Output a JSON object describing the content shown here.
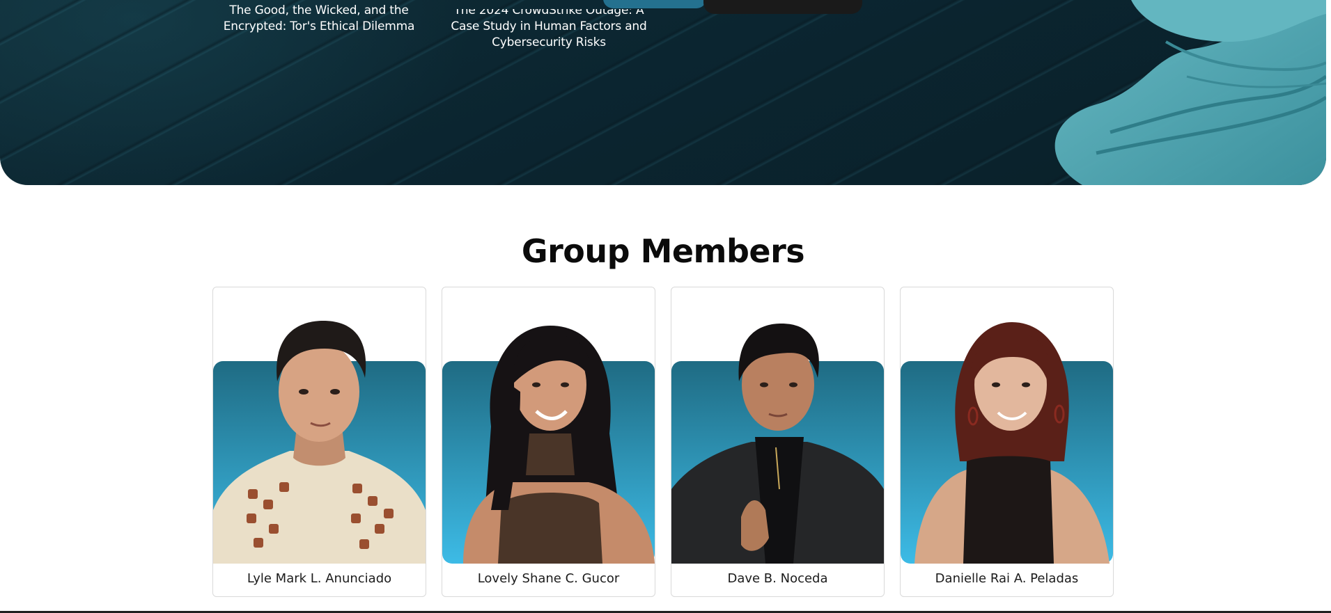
{
  "hero": {
    "cards": [
      {
        "title_line1": "The Good, the Wicked, and the",
        "title_line2": "Encrypted: Tor's Ethical Dilemma"
      },
      {
        "title_line1": "The 2024 CrowdStrike Outage: A",
        "title_line2": "Case Study in Human Factors and",
        "title_line3": "Cybersecurity Risks"
      }
    ]
  },
  "members_section": {
    "title": "Group Members",
    "members": [
      {
        "name": "Lyle Mark L. Anunciado"
      },
      {
        "name": "Lovely Shane C. Gucor"
      },
      {
        "name": "Dave B. Noceda"
      },
      {
        "name": "Danielle Rai A. Peladas"
      }
    ]
  },
  "colors": {
    "hero_dark": "#0b2530",
    "hero_teal": "#5fb3be",
    "photo_bg_top": "#1e6e88",
    "photo_bg_bottom": "#3cb8e4"
  }
}
